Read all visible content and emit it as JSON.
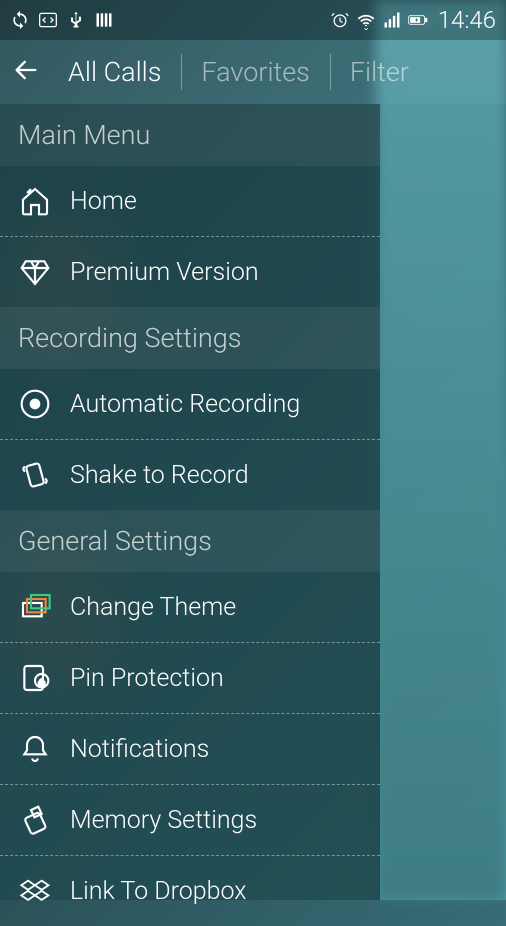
{
  "statusbar": {
    "time": "14:46"
  },
  "actionbar": {
    "tabs": {
      "all_calls": "All Calls",
      "favorites": "Favorites",
      "filter": "Filter"
    }
  },
  "drawer": {
    "section_main": {
      "title": "Main Menu"
    },
    "item_home": "Home",
    "item_premium": "Premium Version",
    "section_recording": {
      "title": "Recording Settings"
    },
    "item_auto_record": "Automatic Recording",
    "item_shake": "Shake to Record",
    "section_general": {
      "title": "General Settings"
    },
    "item_theme": "Change Theme",
    "item_pin": "Pin Protection",
    "item_notifications": "Notifications",
    "item_memory": "Memory Settings",
    "item_dropbox": "Link To Dropbox"
  }
}
